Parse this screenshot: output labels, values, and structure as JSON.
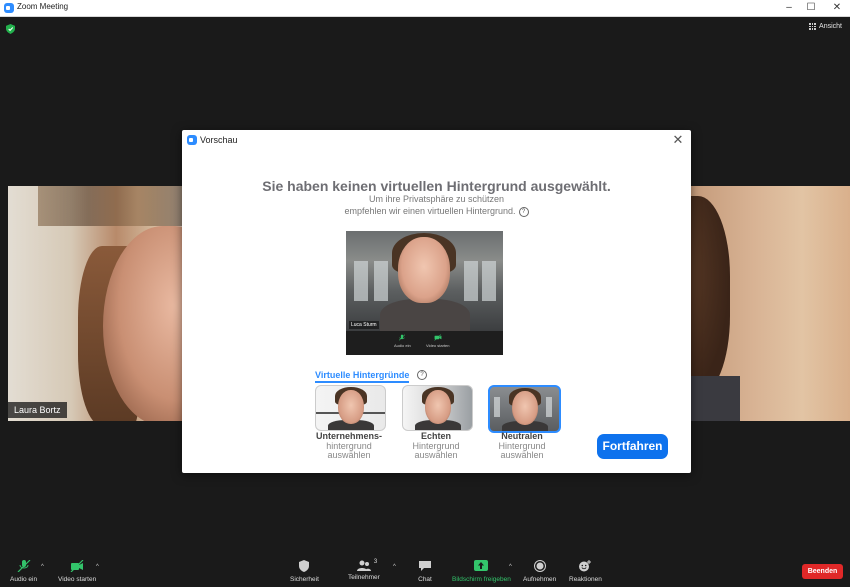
{
  "window": {
    "title": "Zoom Meeting",
    "controls": [
      "–",
      "☐",
      "✕"
    ]
  },
  "meeting": {
    "view_label": "Ansicht",
    "participant_name": "Laura Bortz"
  },
  "modal": {
    "title": "Vorschau",
    "close": "✕",
    "headline": "Sie haben keinen virtuellen Hintergrund ausgewählt.",
    "subtitle_line1": "Um ihre Privatsphäre zu schützen",
    "subtitle_line2": "empfehlen wir einen virtuellen Hintergrund.",
    "help": "?",
    "preview": {
      "self_name": "Luca Sturm",
      "audio_label": "Audio ein",
      "video_label": "Video starten"
    },
    "vb_section_title": "Virtuelle Hintergründe",
    "options": [
      {
        "line1": "Unternehmens-",
        "line2": "hintergrund",
        "line3": "auswählen"
      },
      {
        "line1": "Echten",
        "line2": "Hintergrund",
        "line3": "auswählen"
      },
      {
        "line1": "Neutralen",
        "line2": "Hintergrund",
        "line3": "auswählen"
      }
    ],
    "continue_label": "Fortfahren"
  },
  "toolbar": {
    "audio": "Audio ein",
    "video": "Video starten",
    "security": "Sicherheit",
    "participants": "Teilnehmer",
    "participants_count": "3",
    "chat": "Chat",
    "share": "Bildschirm freigeben",
    "record": "Aufnehmen",
    "reactions": "Reaktionen",
    "end": "Beenden",
    "caret": "^"
  },
  "colors": {
    "accent": "#2d8cff",
    "button": "#0e72ed",
    "share_green": "#33c46b",
    "end_red": "#e02828",
    "meeting_bg": "#1a1a1a"
  }
}
